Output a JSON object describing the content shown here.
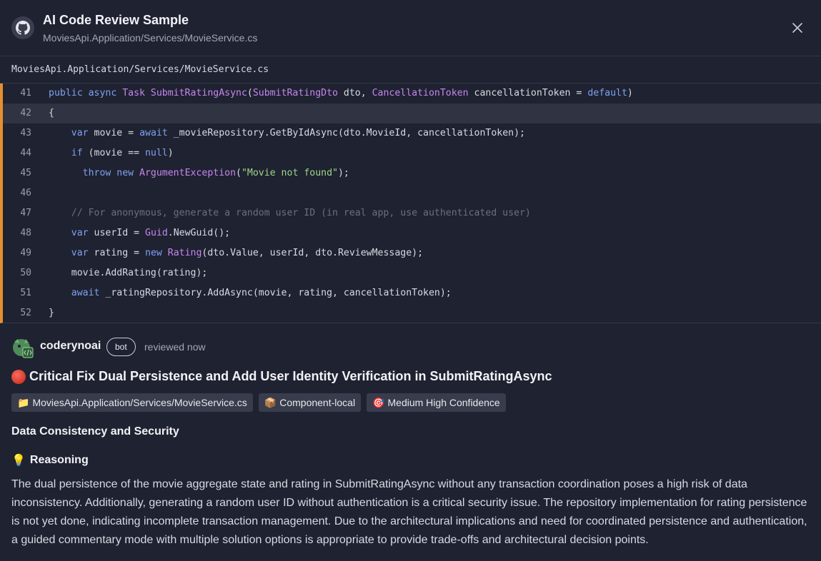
{
  "header": {
    "title": "AI Code Review Sample",
    "subtitle": "MoviesApi.Application/Services/MovieService.cs",
    "logo_icon": "github-icon",
    "close_icon": "close-icon"
  },
  "file_path": "MoviesApi.Application/Services/MovieService.cs",
  "code": {
    "accent_color": "#e58f31",
    "highlighted_line": "42",
    "lines": [
      {
        "n": "41"
      },
      {
        "n": "42"
      },
      {
        "n": "43"
      },
      {
        "n": "44"
      },
      {
        "n": "45"
      },
      {
        "n": "46"
      },
      {
        "n": "47"
      },
      {
        "n": "48"
      },
      {
        "n": "49"
      },
      {
        "n": "50"
      },
      {
        "n": "51"
      },
      {
        "n": "52"
      }
    ],
    "tokens": {
      "l41_a": "public async ",
      "l41_b": "Task ",
      "l41_c": "SubmitRatingAsync",
      "l41_d": "(",
      "l41_e": "SubmitRatingDto",
      "l41_f": " dto, ",
      "l41_g": "CancellationToken",
      "l41_h": " cancellationToken = ",
      "l41_i": "default",
      "l41_j": ")",
      "l42": "{",
      "l43_a": "    var ",
      "l43_b": "movie = ",
      "l43_c": "await",
      "l43_d": " _movieRepository.GetByIdAsync(dto.MovieId, cancellationToken);",
      "l44_a": "    if ",
      "l44_b": "(movie == ",
      "l44_c": "null",
      "l44_d": ")",
      "l45_a": "      throw new ",
      "l45_b": "ArgumentException",
      "l45_c": "(",
      "l45_d": "\"Movie not found\"",
      "l45_e": ");",
      "l47": "    // For anonymous, generate a random user ID (in real app, use authenticated user)",
      "l48_a": "    var ",
      "l48_b": "userId = ",
      "l48_c": "Guid",
      "l48_d": ".NewGuid();",
      "l49_a": "    var ",
      "l49_b": "rating = ",
      "l49_c": "new ",
      "l49_d": "Rating",
      "l49_e": "(dto.Value, userId, dto.ReviewMessage);",
      "l50": "    movie.AddRating(rating);",
      "l51_a": "    await",
      "l51_b": " _ratingRepository.AddAsync(movie, rating, cancellationToken);",
      "l52": "}"
    }
  },
  "review": {
    "author": "coderynoai",
    "badge": "bot",
    "time": "reviewed now",
    "title": "Critical Fix Dual Persistence and Add User Identity Verification in SubmitRatingAsync",
    "status_color": "#d9342b",
    "tags": [
      {
        "icon": "📁",
        "label": "MoviesApi.Application/Services/MovieService.cs"
      },
      {
        "icon": "📦",
        "label": "Component-local"
      },
      {
        "icon": "🎯",
        "label": "Medium High Confidence"
      }
    ],
    "category": "Data Consistency and Security",
    "reasoning_icon": "💡",
    "reasoning_heading": "Reasoning",
    "reasoning_text": "The dual persistence of the movie aggregate state and rating in SubmitRatingAsync without any transaction coordination poses a high risk of data inconsistency. Additionally, generating a random user ID without authentication is a critical security issue. The repository implementation for rating persistence is not yet done, indicating incomplete transaction management. Due to the architectural implications and need for coordinated persistence and authentication, a guided commentary mode with multiple solution options is appropriate to provide trade-offs and architectural decision points."
  }
}
